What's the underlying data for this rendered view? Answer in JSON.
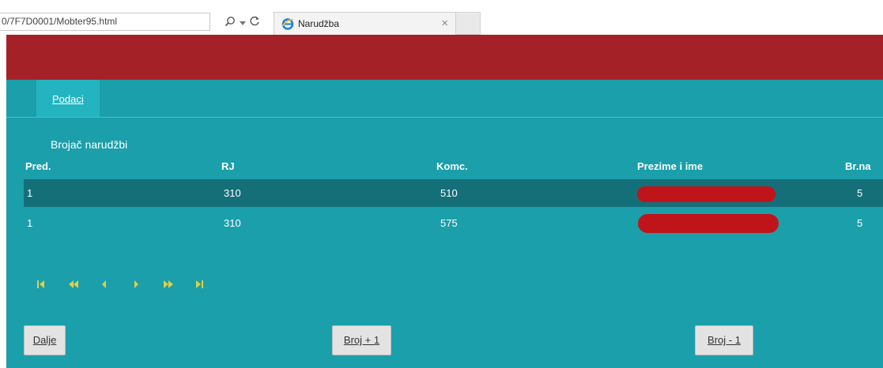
{
  "browser": {
    "address": "0/7F7D0001/Mobter95.html",
    "tab_title": "Narudžba",
    "search_icon": "search-icon",
    "dropdown_icon": "chevron-down-icon",
    "refresh_icon": "refresh-icon",
    "close_tab": "×"
  },
  "colors": {
    "header_red": "#a52128",
    "app_bg": "#1a9fab",
    "tab_active": "#23b4c0",
    "selected_row": "#146f79",
    "pager_icon": "#ddd04a",
    "redaction": "#c0141b"
  },
  "tabs": [
    {
      "label": "Podaci",
      "active": true
    }
  ],
  "main": {
    "caption": "Brojač narudžbi",
    "columns": [
      "Pred.",
      "RJ",
      "Komc.",
      "Prezime i ime",
      "Br.na"
    ],
    "rows": [
      {
        "pred": "1",
        "rj": "310",
        "komc": "510",
        "prezime": "",
        "br": "5",
        "selected": true
      },
      {
        "pred": "1",
        "rj": "310",
        "komc": "575",
        "prezime": "",
        "br": "5",
        "selected": false
      }
    ]
  },
  "pager": {
    "first": "⏮",
    "prev_page": "⏪",
    "prev": "◀",
    "next": "▶",
    "next_page": "⏩",
    "last": "⏭"
  },
  "buttons": {
    "dalje": "Dalje",
    "broj_plus": "Broj + 1",
    "broj_minus": "Broj - 1"
  }
}
